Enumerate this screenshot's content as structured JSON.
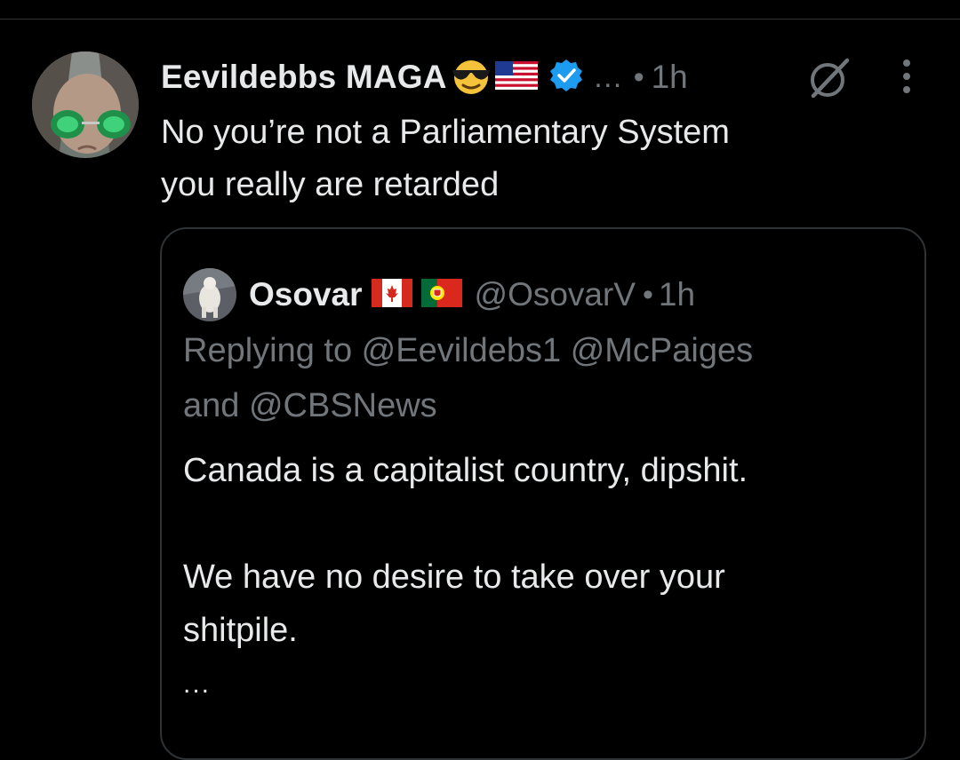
{
  "tweet": {
    "author": {
      "display_name": "Eevildebbs MAGA",
      "name_emojis": [
        "smiling-face-with-sunglasses",
        "us-flag"
      ],
      "verified": true,
      "verified_color": "#1d9bf0",
      "avatar_icon": "avatar-green-sunglasses"
    },
    "overflow": "…",
    "dot": "•",
    "time": "1h",
    "actions": {
      "grok_icon": "grok-icon",
      "more_icon": "more-vertical-icon"
    },
    "text_lines": [
      "No you’re not a  Parliamentary System",
      "you really are retarded"
    ]
  },
  "quote": {
    "author": {
      "display_name": "Osovar",
      "flags": [
        "canada-flag",
        "portugal-flag"
      ],
      "handle": "@OsovarV",
      "avatar_icon": "avatar-polar-bear"
    },
    "dot": "•",
    "time": "1h",
    "replying_lines": [
      "Replying to @Eevildebs1 @McPaiges",
      "and @CBSNews"
    ],
    "body": {
      "para1": "Canada is a capitalist country, dipshit.",
      "para2_line1": "We have no desire to take over your",
      "para2_line2": "shitpile."
    },
    "more": "..."
  },
  "colors": {
    "background": "#000000",
    "text_primary": "#e7e9ea",
    "text_secondary": "#71767b",
    "border": "#2f3336",
    "verified": "#1d9bf0"
  }
}
